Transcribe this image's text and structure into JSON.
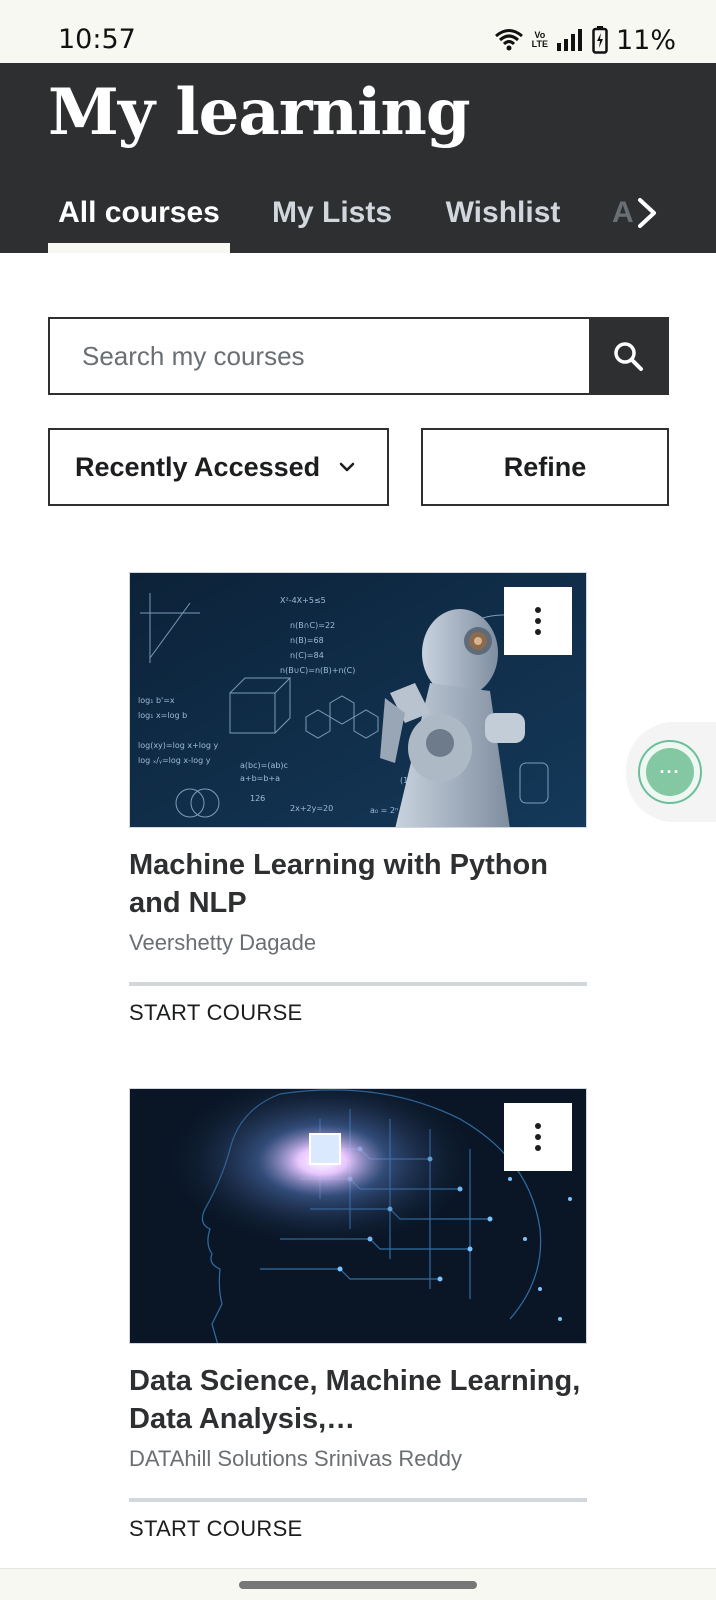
{
  "status_bar": {
    "time": "10:57",
    "battery": "11%",
    "network_label_top": "Vo",
    "network_label_bottom": "LTE",
    "icons": [
      "wifi-icon",
      "volte-icon",
      "signal-icon",
      "battery-icon"
    ]
  },
  "header": {
    "title": "My learning",
    "tabs": [
      {
        "label": "All courses",
        "active": true
      },
      {
        "label": "My Lists",
        "active": false
      },
      {
        "label": "Wishlist",
        "active": false
      },
      {
        "label": "A",
        "active": false
      }
    ],
    "next_icon": "chevron-right-icon"
  },
  "search": {
    "placeholder": "Search my courses",
    "value": "",
    "icon": "search-icon"
  },
  "filters": {
    "sort_label": "Recently Accessed",
    "sort_icon": "chevron-down-icon",
    "refine_label": "Refine"
  },
  "courses": [
    {
      "title": "Machine Learning with Python and NLP",
      "instructor": "Veershetty Dagade",
      "status": "START COURSE",
      "progress": 0,
      "thumbnail": "robot-formulas-thumbnail"
    },
    {
      "title": "Data Science, Machine Learning, Data Analysis,…",
      "instructor": "DATAhill Solutions Srinivas Reddy",
      "status": "START COURSE",
      "progress": 0,
      "thumbnail": "circuit-brain-thumbnail"
    }
  ],
  "chat": {
    "icon": "chat-bubble-icon",
    "label": "···"
  },
  "colors": {
    "header_bg": "#2d2f31",
    "status_bg": "#f6f8f1",
    "tab_active": "#ffffff",
    "tab_inactive": "#d1d7dc",
    "chat_accent": "#83c8a3"
  }
}
